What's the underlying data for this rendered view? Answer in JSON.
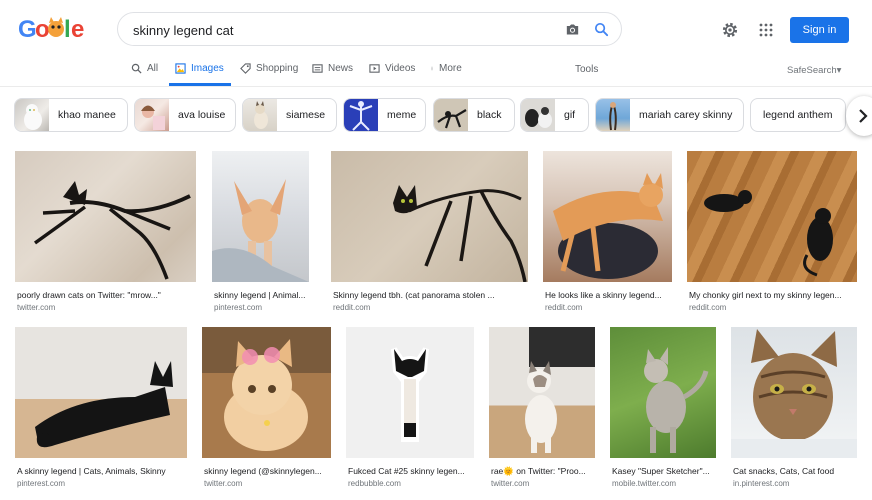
{
  "header": {
    "logo_alt": "Google",
    "query": "skinny legend cat",
    "signin_label": "Sign in"
  },
  "tabs": [
    {
      "label": "All",
      "icon": "search-icon"
    },
    {
      "label": "Images",
      "icon": "image-icon"
    },
    {
      "label": "Shopping",
      "icon": "tag-icon"
    },
    {
      "label": "News",
      "icon": "news-icon"
    },
    {
      "label": "Videos",
      "icon": "video-icon"
    },
    {
      "label": "More",
      "icon": "more-vert-icon"
    }
  ],
  "tools_label": "Tools",
  "safesearch_label": "SafeSearch▾",
  "chips": [
    {
      "label": "khao manee",
      "has_thumb": true
    },
    {
      "label": "ava louise",
      "has_thumb": true
    },
    {
      "label": "siamese",
      "has_thumb": true
    },
    {
      "label": "meme",
      "has_thumb": true
    },
    {
      "label": "black",
      "has_thumb": true
    },
    {
      "label": "gif",
      "has_thumb": true
    },
    {
      "label": "mariah carey skinny",
      "has_thumb": true
    },
    {
      "label": "legend anthem",
      "has_thumb": false
    }
  ],
  "results": [
    {
      "caption": "poorly drawn cats on Twitter: \"mrow...\"",
      "source": "twitter.com"
    },
    {
      "caption": "skinny legend | Animal...",
      "source": "pinterest.com"
    },
    {
      "caption": "Skinny legend tbh. (cat panorama stolen ...",
      "source": "reddit.com"
    },
    {
      "caption": "He looks like a skinny legend...",
      "source": "reddit.com"
    },
    {
      "caption": "My chonky girl next to my skinny legen...",
      "source": "reddit.com"
    },
    {
      "caption": "A skinny legend | Cats, Animals, Skinny",
      "source": "pinterest.com"
    },
    {
      "caption": "skinny legend (@skinnylegen...",
      "source": "twitter.com"
    },
    {
      "caption": "Fukced Cat #25 skinny legen...",
      "source": "redbubble.com"
    },
    {
      "caption": "rae🌞 on Twitter: \"Proo...",
      "source": "twitter.com"
    },
    {
      "caption": "Kasey \"Super Sketcher\"...",
      "source": "mobile.twitter.com"
    },
    {
      "caption": "Cat snacks, Cats, Cat food",
      "source": "in.pinterest.com"
    }
  ],
  "colors": {
    "accent": "#1a73e8",
    "text": "#202124",
    "muted": "#70757a"
  }
}
